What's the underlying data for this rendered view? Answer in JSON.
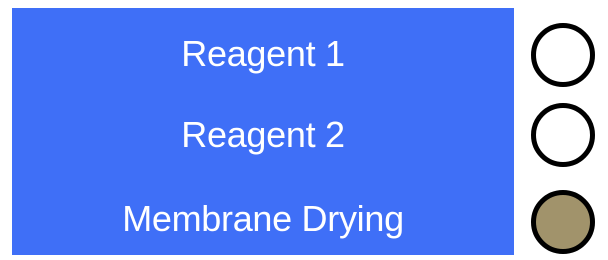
{
  "colors": {
    "panel": "#3f6ff7",
    "indicator_off": "#ffffff",
    "indicator_on": "#a1936b",
    "indicator_border": "#000000"
  },
  "steps": [
    {
      "label": "Reagent 1",
      "indicator_state": "off"
    },
    {
      "label": "Reagent 2",
      "indicator_state": "off"
    },
    {
      "label": "Membrane Drying",
      "indicator_state": "on"
    }
  ]
}
